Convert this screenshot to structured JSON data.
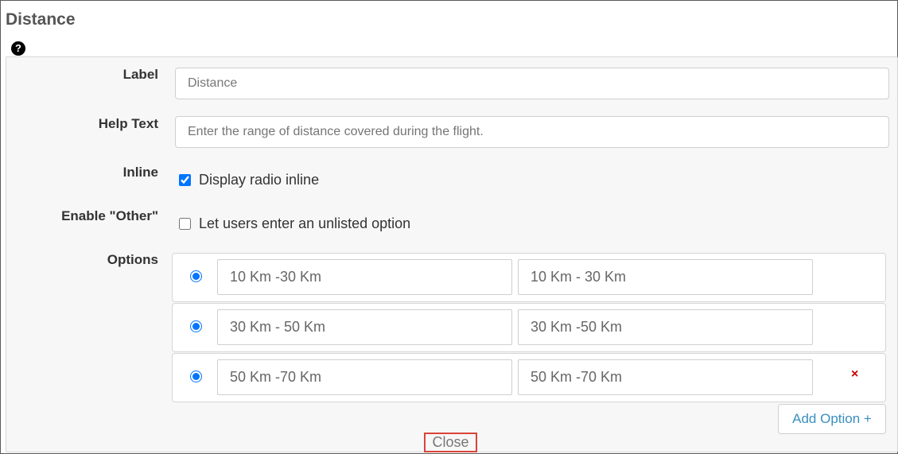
{
  "dialog": {
    "title": "Distance",
    "help_icon": "?"
  },
  "form": {
    "label": {
      "label": "Label",
      "value": "Distance"
    },
    "help_text": {
      "label": "Help Text",
      "value": "Enter the range of distance covered during the flight."
    },
    "inline": {
      "label": "Inline",
      "checkbox_label": "Display radio inline",
      "checked": true
    },
    "enable_other": {
      "label": "Enable \"Other\"",
      "checkbox_label": "Let users enter an unlisted option",
      "checked": false
    },
    "options": {
      "label": "Options",
      "rows": [
        {
          "label_value": "10 Km -30 Km",
          "value": "10 Km - 30 Km"
        },
        {
          "label_value": "30 Km - 50 Km",
          "value": "30 Km -50 Km"
        },
        {
          "label_value": "50 Km -70 Km",
          "value": "50 Km -70 Km",
          "removable": true
        }
      ],
      "remove_icon": "×",
      "add_label": "Add Option +"
    }
  },
  "footer": {
    "close_label": "Close"
  },
  "colors": {
    "accent": "#3a8fc0",
    "remove": "#cc0000",
    "highlight_border": "#d9443a"
  }
}
